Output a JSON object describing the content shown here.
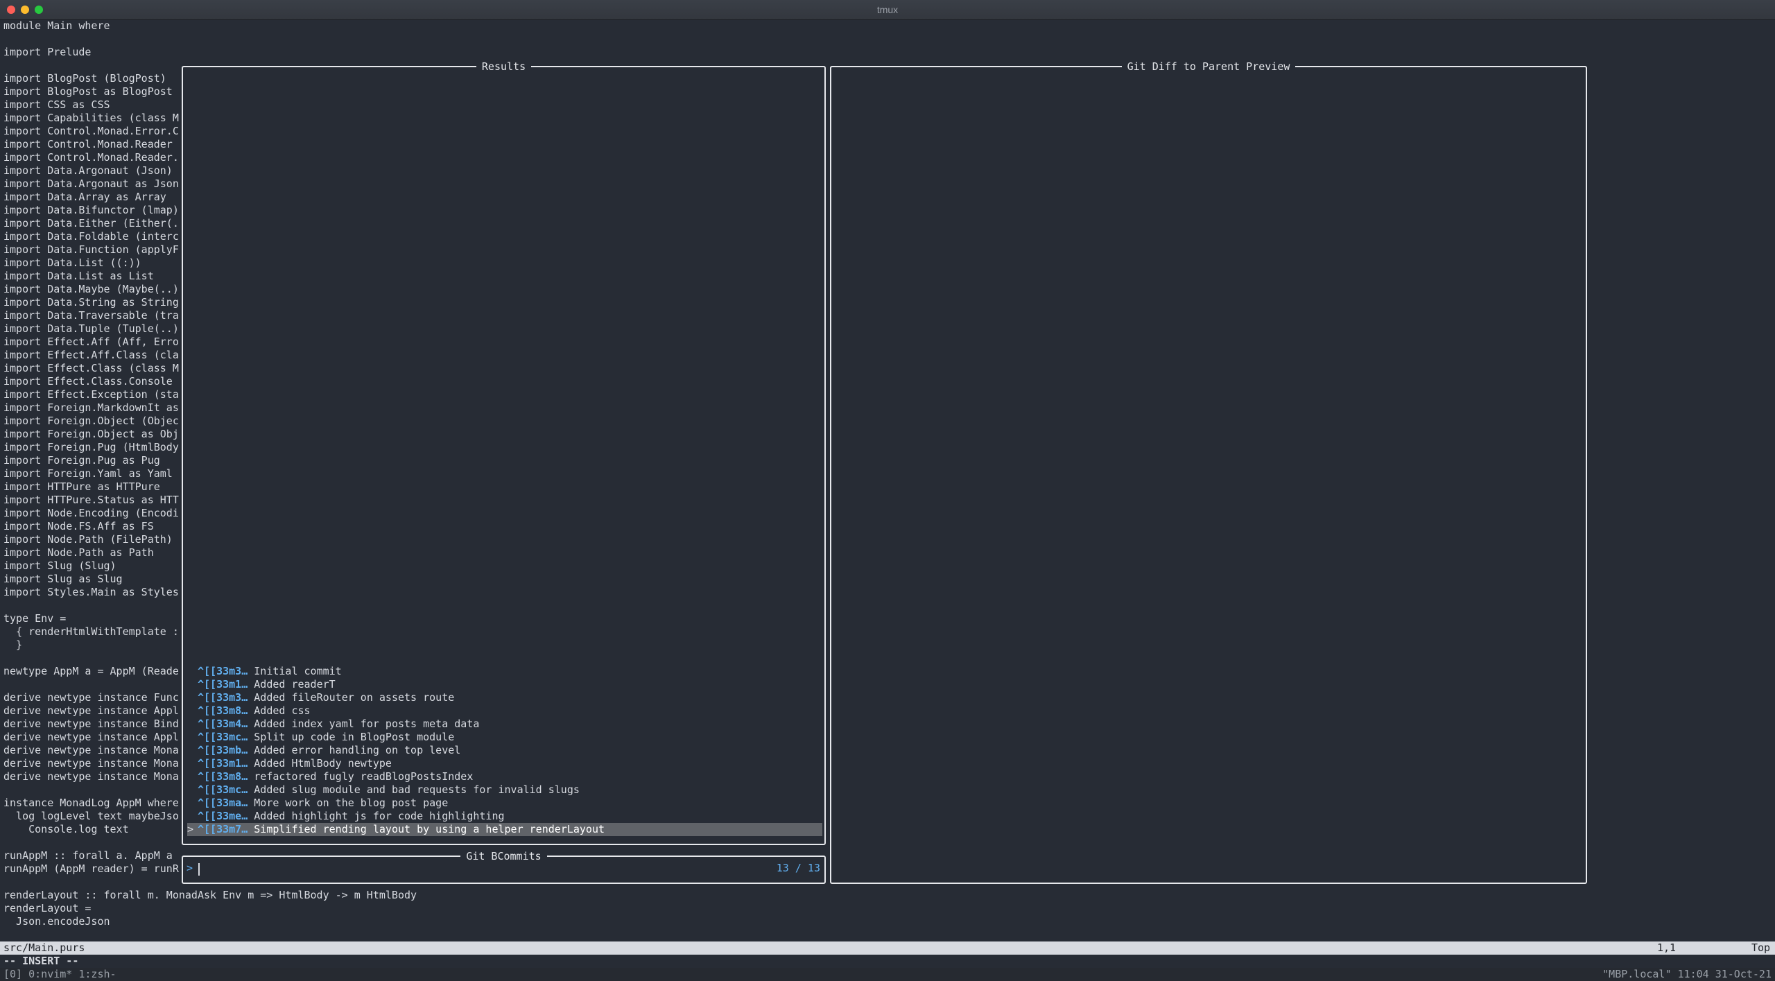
{
  "window": {
    "title": "tmux"
  },
  "editor": {
    "lines": [
      "module Main where",
      "",
      "import Prelude",
      "",
      "import BlogPost (BlogPost)",
      "import BlogPost as BlogPost",
      "import CSS as CSS",
      "import Capabilities (class M",
      "import Control.Monad.Error.C",
      "import Control.Monad.Reader",
      "import Control.Monad.Reader.",
      "import Data.Argonaut (Json)",
      "import Data.Argonaut as Json",
      "import Data.Array as Array",
      "import Data.Bifunctor (lmap)",
      "import Data.Either (Either(.",
      "import Data.Foldable (interc",
      "import Data.Function (applyF",
      "import Data.List ((:))",
      "import Data.List as List",
      "import Data.Maybe (Maybe(..)",
      "import Data.String as String",
      "import Data.Traversable (tra",
      "import Data.Tuple (Tuple(..)",
      "import Effect.Aff (Aff, Erro",
      "import Effect.Aff.Class (cla",
      "import Effect.Class (class M",
      "import Effect.Class.Console",
      "import Effect.Exception (sta",
      "import Foreign.MarkdownIt as",
      "import Foreign.Object (Objec",
      "import Foreign.Object as Obj",
      "import Foreign.Pug (HtmlBody",
      "import Foreign.Pug as Pug",
      "import Foreign.Yaml as Yaml",
      "import HTTPure as HTTPure",
      "import HTTPure.Status as HTT",
      "import Node.Encoding (Encodi",
      "import Node.FS.Aff as FS",
      "import Node.Path (FilePath)",
      "import Node.Path as Path",
      "import Slug (Slug)",
      "import Slug as Slug",
      "import Styles.Main as Styles",
      "",
      "type Env =",
      "  { renderHtmlWithTemplate :",
      "  }",
      "",
      "newtype AppM a = AppM (Reade",
      "",
      "derive newtype instance Func",
      "derive newtype instance Appl",
      "derive newtype instance Bind",
      "derive newtype instance Appl",
      "derive newtype instance Mona",
      "derive newtype instance Mona",
      "derive newtype instance Mona",
      "",
      "instance MonadLog AppM where",
      "  log logLevel text maybeJso",
      "    Console.log text",
      "",
      "runAppM :: forall a. AppM a",
      "runAppM (AppM reader) = runR",
      "",
      "renderLayout :: forall m. MonadAsk Env m => HtmlBody -> m HtmlBody",
      "renderLayout =",
      "  Json.encodeJson"
    ]
  },
  "results_pane": {
    "title": "Results",
    "commits": [
      {
        "hash": "^[[33m3…",
        "message": "Initial commit"
      },
      {
        "hash": "^[[33m1…",
        "message": "Added readerT"
      },
      {
        "hash": "^[[33m3…",
        "message": "Added fileRouter on assets route"
      },
      {
        "hash": "^[[33m8…",
        "message": "Added css"
      },
      {
        "hash": "^[[33m4…",
        "message": "Added index yaml for posts meta data"
      },
      {
        "hash": "^[[33mc…",
        "message": "Split up code in BlogPost module"
      },
      {
        "hash": "^[[33mb…",
        "message": "Added error handling on top level"
      },
      {
        "hash": "^[[33m1…",
        "message": "Added HtmlBody newtype"
      },
      {
        "hash": "^[[33m8…",
        "message": "refactored fugly readBlogPostsIndex"
      },
      {
        "hash": "^[[33mc…",
        "message": "Added slug module and bad requests for invalid slugs"
      },
      {
        "hash": "^[[33ma…",
        "message": "More work on the blog post page"
      },
      {
        "hash": "^[[33me…",
        "message": "Added highlight js for code highlighting"
      },
      {
        "hash": "^[[33m7…",
        "message": "Simplified rending layout by using a helper renderLayout"
      }
    ],
    "selected_index": 12,
    "selection_marker": ">"
  },
  "preview_pane": {
    "title": "Git Diff to Parent Preview"
  },
  "prompt_pane": {
    "title": "Git BCommits",
    "prompt": ">",
    "query": "",
    "count": "13 / 13"
  },
  "vim_status": {
    "file": "src/Main.purs",
    "position": "1,1",
    "scroll": "Top",
    "mode": "-- INSERT --"
  },
  "tmux_status": {
    "left": "[0] 0:nvim* 1:zsh-",
    "right": "\"MBP.local\" 11:04 31-Oct-21"
  },
  "colors": {
    "background": "#272c35",
    "hash": "#61afef",
    "selection": "#606368",
    "border": "#e6e8ec"
  }
}
